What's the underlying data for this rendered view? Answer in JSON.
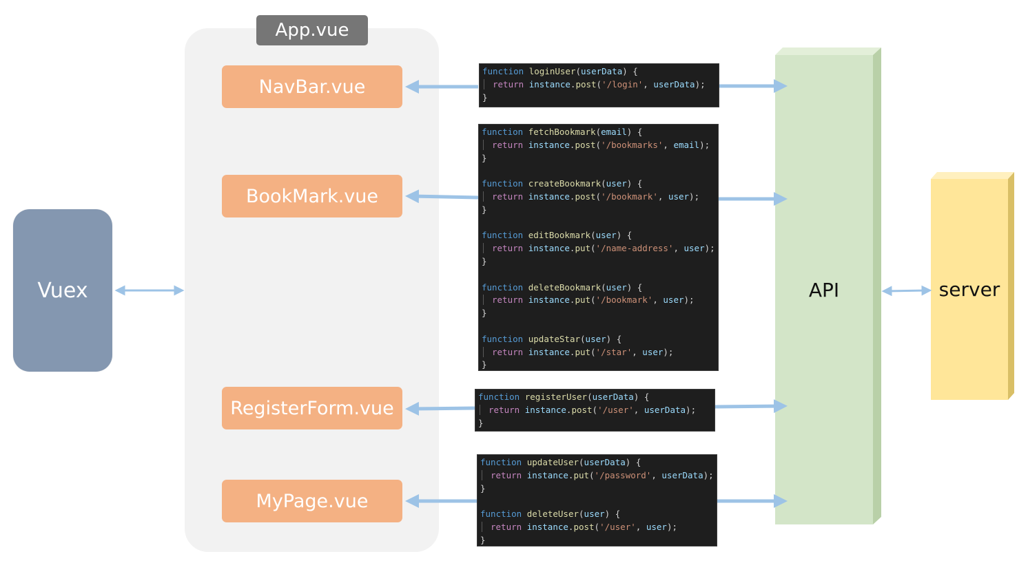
{
  "vuex": {
    "label": "Vuex"
  },
  "app": {
    "title": "App.vue"
  },
  "components": [
    {
      "label": "NavBar.vue"
    },
    {
      "label": "BookMark.vue"
    },
    {
      "label": "RegisterForm.vue"
    },
    {
      "label": "MyPage.vue"
    }
  ],
  "api": {
    "label": "API"
  },
  "server": {
    "label": "server"
  },
  "code": {
    "navbar": {
      "functions": [
        {
          "name": "loginUser",
          "param": "userData",
          "method": "post",
          "path": "'/login'",
          "arg": "userData"
        }
      ]
    },
    "bookmark": {
      "functions": [
        {
          "name": "fetchBookmark",
          "param": "email",
          "method": "post",
          "path": "'/bookmarks'",
          "arg": "email"
        },
        {
          "name": "createBookmark",
          "param": "user",
          "method": "post",
          "path": "'/bookmark'",
          "arg": "user"
        },
        {
          "name": "editBookmark",
          "param": "user",
          "method": "put",
          "path": "'/name-address'",
          "arg": "user"
        },
        {
          "name": "deleteBookmark",
          "param": "user",
          "method": "put",
          "path": "'/bookmark'",
          "arg": "user"
        },
        {
          "name": "updateStar",
          "param": "user",
          "method": "put",
          "path": "'/star'",
          "arg": "user"
        }
      ]
    },
    "register": {
      "functions": [
        {
          "name": "registerUser",
          "param": "userData",
          "method": "post",
          "path": "'/user'",
          "arg": "userData"
        }
      ]
    },
    "mypage": {
      "functions": [
        {
          "name": "updateUser",
          "param": "userData",
          "method": "put",
          "path": "'/password'",
          "arg": "userData"
        },
        {
          "name": "deleteUser",
          "param": "user",
          "method": "post",
          "path": "'/user'",
          "arg": "user"
        }
      ]
    }
  },
  "colors": {
    "vuex": "#8497b0",
    "component": "#f4b183",
    "app_title": "#767676",
    "api": "#d3e5c8",
    "server": "#ffe699",
    "arrow": "#9dc3e6"
  }
}
